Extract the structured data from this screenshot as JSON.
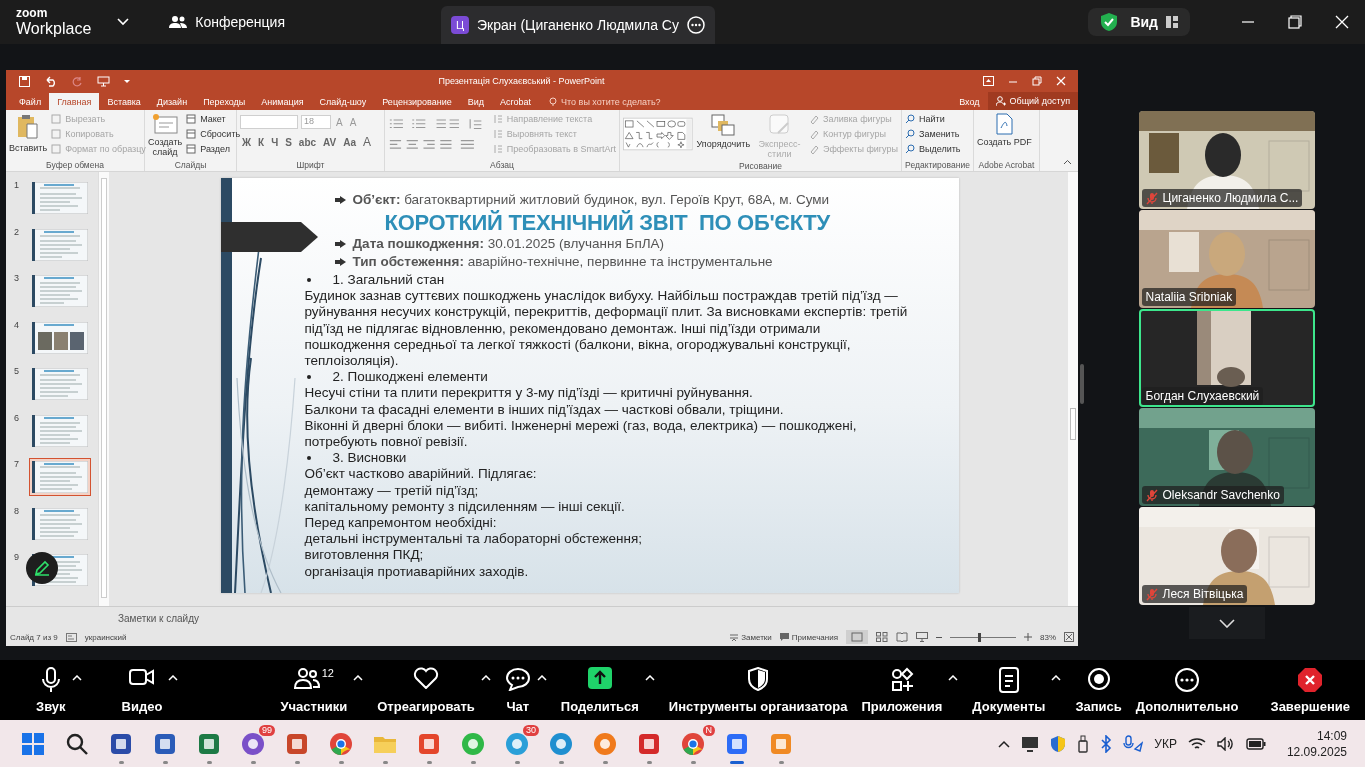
{
  "zoom_header": {
    "logo": "zoom",
    "product": "Workplace",
    "meeting_tab": "Конференция",
    "share_tab": {
      "badge": "Ц",
      "label": "Экран (Циганенко Людмила Су",
      "selected": true
    },
    "view": "Вид"
  },
  "powerpoint": {
    "title": "Презентація Слухаєвський - PowerPoint",
    "tabs": [
      {
        "label": "Файл",
        "selected": false
      },
      {
        "label": "Главная",
        "selected": true
      },
      {
        "label": "Вставка",
        "selected": false
      },
      {
        "label": "Дизайн",
        "selected": false
      },
      {
        "label": "Переходы",
        "selected": false
      },
      {
        "label": "Анимация",
        "selected": false
      },
      {
        "label": "Слайд-шоу",
        "selected": false
      },
      {
        "label": "Рецензирование",
        "selected": false
      },
      {
        "label": "Вид",
        "selected": false
      },
      {
        "label": "Acrobat",
        "selected": false
      }
    ],
    "tell_me": "Что вы хотите сделать?",
    "sign_in": "Вход",
    "share": "Общий доступ",
    "ribbon": {
      "clipboard": {
        "label": "Буфер обмена",
        "paste": "Вставить",
        "items": [
          {
            "label": "Вырезать",
            "disabled": true
          },
          {
            "label": "Копировать",
            "disabled": true
          },
          {
            "label": "Формат по образцу",
            "disabled": true
          }
        ]
      },
      "slides": {
        "label": "Слайды",
        "new_slide": "Создать слайд",
        "items": [
          {
            "label": "Макет",
            "disabled": false
          },
          {
            "label": "Сбросить",
            "disabled": false
          },
          {
            "label": "Раздел",
            "disabled": false
          }
        ]
      },
      "font": {
        "label": "Шрифт",
        "size": "18",
        "size_buttons": [
          "A",
          "A"
        ],
        "format_buttons": [
          "Ж",
          "К",
          "Ч",
          "S",
          "abc",
          "AV",
          "Aa"
        ],
        "color_button": "A"
      },
      "paragraph": {
        "label": "Абзац",
        "items": [
          {
            "label": "Направление текста",
            "disabled": true
          },
          {
            "label": "Выровнять текст",
            "disabled": true
          },
          {
            "label": "Преобразовать в SmartArt",
            "disabled": true
          }
        ]
      },
      "drawing": {
        "label": "Рисование",
        "arrange": "Упорядочить",
        "quick_styles": {
          "label": "Экспресс-стили",
          "disabled": true
        },
        "items": [
          {
            "label": "Заливка фигуры",
            "disabled": true
          },
          {
            "label": "Контур фигуры",
            "disabled": true
          },
          {
            "label": "Эффекты фигуры",
            "disabled": true
          }
        ]
      },
      "editing": {
        "label": "Редактирование",
        "items": [
          {
            "label": "Найти",
            "disabled": false
          },
          {
            "label": "Заменить",
            "disabled": false
          },
          {
            "label": "Выделить",
            "disabled": false
          }
        ]
      },
      "acrobat": {
        "label": "Adobe Acrobat",
        "create_pdf": "Создать PDF"
      }
    },
    "thumbnails": [
      {
        "number": "1",
        "selected": false
      },
      {
        "number": "2",
        "selected": false
      },
      {
        "number": "3",
        "selected": false
      },
      {
        "number": "4",
        "selected": false
      },
      {
        "number": "5",
        "selected": false
      },
      {
        "number": "6",
        "selected": false
      },
      {
        "number": "7",
        "selected": true
      },
      {
        "number": "8",
        "selected": false
      },
      {
        "number": "9",
        "selected": false
      }
    ],
    "slide": {
      "title": "КОРОТКИЙ ТЕХНІЧНИЙ ЗВІТ  ПО ОБ'ЄКТУ",
      "header_bullets": [
        "**Об’єкт:** багатоквартирний житловий будинок, вул. Героїв Крут, 68А, м. Суми",
        "**Дата пошкодження:** 30.01.2025 (влучання БпЛА)",
        "**Тип обстеження:** аварійно-технічне, первинне та інструментальне"
      ],
      "body": [
        {
          "kind": "bullet",
          "text": "1. Загальний стан"
        },
        {
          "kind": "text",
          "text": "Будинок зазнав суттєвих пошкоджень унаслідок вибуху. Найбільш постраждав третій під’їзд — руйнування несучих конструкцій, перекриттів, деформації плит. За висновками експертів: третій під’їзд не підлягає відновленню, рекомендовано демонтаж. Інші під’їзди отримали пошкодження середньої та легкої тяжкості (балкони, вікна, огороджувальні конструкції, теплоізоляція)."
        },
        {
          "kind": "bullet",
          "text": "2. Пошкоджені елементи"
        },
        {
          "kind": "text",
          "text": "Несучі стіни та плити перекриття у 3-му під’їзді — критичні руйнування."
        },
        {
          "kind": "text",
          "text": "Балкони та фасадні елементи в інших під’їздах — часткові обвали, тріщини."
        },
        {
          "kind": "text",
          "text": "Віконні й дверні блоки — вибиті. Інженерні мережі (газ, вода, електрика) — пошкоджені, потребують повної ревізії."
        },
        {
          "kind": "bullet",
          "text": "3. Висновки"
        },
        {
          "kind": "text",
          "text": "Об’єкт частково аварійний. Підлягає:"
        },
        {
          "kind": "text",
          "text": "демонтажу — третій під’їзд;"
        },
        {
          "kind": "text",
          "text": "капітальному ремонту з підсиленням — інші секції."
        },
        {
          "kind": "text",
          "text": "Перед капремонтом необхідні:"
        },
        {
          "kind": "text",
          "text": "детальні інструментальні та лабораторні обстеження;"
        },
        {
          "kind": "text",
          "text": "виготовлення ПКД;"
        },
        {
          "kind": "text",
          "text": "організація протиаварійних заходів."
        }
      ]
    },
    "notes_placeholder": "Заметки к слайду",
    "status_bar": {
      "slide_info": "Слайд 7 из 9",
      "language": "украинский",
      "notes": "Заметки",
      "comments": "Примечания",
      "zoom_slider": {
        "level": 0.42
      },
      "zoom": "83%"
    }
  },
  "participants": [
    {
      "name": "Циганенко Людмила С...",
      "muted": true,
      "speaking": false
    },
    {
      "name": "Nataliia Sribniak",
      "muted": false,
      "speaking": false
    },
    {
      "name": "Богдан Слухаевский",
      "muted": false,
      "speaking": true
    },
    {
      "name": "Oleksandr Savchenko",
      "muted": true,
      "speaking": false
    },
    {
      "name": "Леся Вітвіцька",
      "muted": true,
      "speaking": false
    }
  ],
  "zoom_toolbar": {
    "left": [
      {
        "kind": "mic",
        "label": "Звук",
        "caret": true
      },
      {
        "kind": "video",
        "label": "Видео",
        "caret": true
      }
    ],
    "center": [
      {
        "kind": "participants",
        "label": "Участники",
        "count": "12",
        "caret": true
      },
      {
        "kind": "react",
        "label": "Отреагировать",
        "caret": true
      },
      {
        "kind": "chat",
        "label": "Чат",
        "caret": true
      },
      {
        "kind": "share",
        "label": "Поделиться",
        "caret": true
      },
      {
        "kind": "host",
        "label": "Инструменты организатора",
        "caret": false
      },
      {
        "kind": "apps",
        "label": "Приложения",
        "caret": true
      },
      {
        "kind": "docs",
        "label": "Документы",
        "caret": true
      },
      {
        "kind": "record",
        "label": "Запись",
        "caret": false
      },
      {
        "kind": "more",
        "label": "Дополнительно",
        "caret": false
      }
    ],
    "right": [
      {
        "kind": "end",
        "label": "Завершение",
        "caret": false
      }
    ]
  },
  "taskbar": {
    "apps": [
      {
        "kind": "start"
      },
      {
        "kind": "search"
      },
      {
        "kind": "floppy",
        "running": true,
        "active": false
      },
      {
        "kind": "word",
        "running": true,
        "active": false
      },
      {
        "kind": "excel",
        "running": true,
        "active": false
      },
      {
        "kind": "viber",
        "running": true,
        "active": false,
        "badge": "99"
      },
      {
        "kind": "powerpoint",
        "running": true,
        "active": false
      },
      {
        "kind": "chrome",
        "running": true,
        "active": false
      },
      {
        "kind": "folder",
        "running": true,
        "active": false
      },
      {
        "kind": "red-app",
        "running": true,
        "active": false
      },
      {
        "kind": "whatsapp",
        "running": true,
        "active": false
      },
      {
        "kind": "telegram",
        "running": true,
        "active": false,
        "badge": "30"
      },
      {
        "kind": "edge",
        "running": true,
        "active": false
      },
      {
        "kind": "firefox",
        "running": true,
        "active": false
      },
      {
        "kind": "red-app2",
        "running": true,
        "active": false
      },
      {
        "kind": "chrome",
        "running": true,
        "active": false,
        "badge": "N"
      },
      {
        "kind": "zoom",
        "running": true,
        "active": true
      },
      {
        "kind": "pdf",
        "running": true,
        "active": false
      }
    ],
    "language": "УКР",
    "time": "14:09",
    "date": "12.09.2025"
  }
}
